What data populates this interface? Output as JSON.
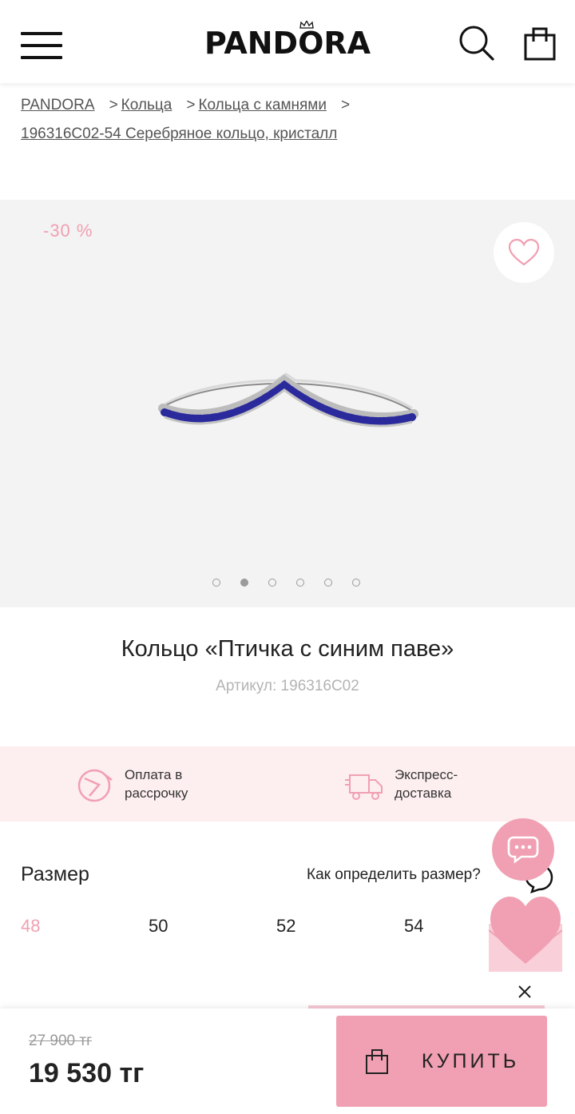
{
  "header": {
    "logo": "PANDORA",
    "menu_icon": "hamburger-icon",
    "search_icon": "search-icon",
    "cart_icon": "bag-icon"
  },
  "breadcrumb": {
    "items": [
      "PANDORA",
      "Кольца",
      "Кольца с камнями",
      "196316C02-54 Серебряное кольцо, кристалл"
    ]
  },
  "gallery": {
    "discount": "-30 %",
    "favorite_icon": "heart-icon",
    "image_icon": "ring-image",
    "slide_count": 6,
    "active_slide": 2
  },
  "product": {
    "title": "Кольцо «Птичка с синим паве»",
    "article": "Артикул: 196316C02"
  },
  "features": {
    "installment": "Оплата в\nрассрочку",
    "installment_icon": "installment-icon",
    "delivery": "Экспресс-\nдоставка",
    "delivery_icon": "truck-icon"
  },
  "size": {
    "label": "Размер",
    "help": "Как определить размер?",
    "options": [
      "48",
      "50",
      "52",
      "54"
    ],
    "selected": "48"
  },
  "price": {
    "old": "27 900 тг",
    "current": "19 530 тг"
  },
  "buy": {
    "label": "КУПИТЬ",
    "icon": "bag-icon"
  },
  "colors": {
    "accent_pink": "#f0a0b2",
    "band_pink": "#fdeef0",
    "ring_stone_blue": "#2a2a9c"
  }
}
